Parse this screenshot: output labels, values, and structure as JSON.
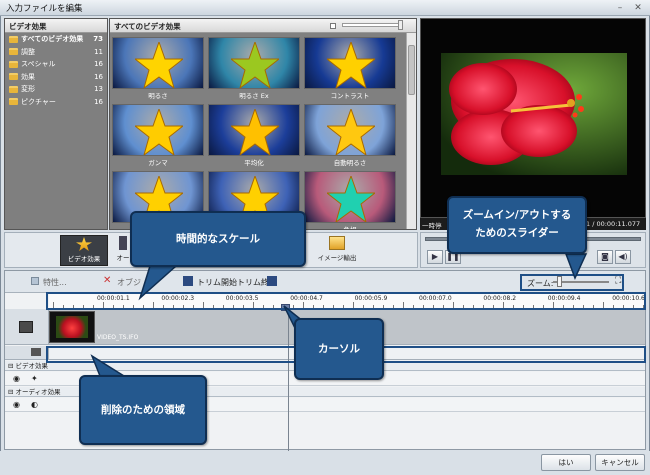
{
  "window": {
    "title": "入力ファイルを編集"
  },
  "categories": {
    "header": "ビデオ効果",
    "items": [
      {
        "label": "すべてのビデオ効果",
        "count": "73",
        "selected": true
      },
      {
        "label": "調整",
        "count": "11"
      },
      {
        "label": "スペシャル",
        "count": "16"
      },
      {
        "label": "効果",
        "count": "16"
      },
      {
        "label": "変形",
        "count": "13"
      },
      {
        "label": "ピクチャー",
        "count": "16"
      }
    ]
  },
  "effects": {
    "header": "すべてのビデオ効果",
    "tiles": [
      {
        "label": "明るさ",
        "bg": "#4b76b8",
        "star": "#ffd400"
      },
      {
        "label": "明るさ Ex",
        "bg": "#2f86a8",
        "star": "#9bc820"
      },
      {
        "label": "コントラスト",
        "bg": "#163a94",
        "star": "#ffd000"
      },
      {
        "label": "ガンマ",
        "bg": "#5f8fd0",
        "star": "#ffcc00"
      },
      {
        "label": "平均化",
        "bg": "#1c3e9a",
        "star": "#ffc000"
      },
      {
        "label": "自動明るさ",
        "bg": "#7ea3d8",
        "star": "#ffc810"
      },
      {
        "label": "",
        "bg": "#6f95d2",
        "star": "#ffd000"
      },
      {
        "label": "",
        "bg": "#3e62b6",
        "star": "#ffd000"
      },
      {
        "label": "色相",
        "bg": "#b85a7a",
        "star": "#20d0b0"
      }
    ]
  },
  "preview": {
    "time_left": "一時停",
    "time_right": "1 / 00:00:11.077"
  },
  "toolbar": {
    "video_effects": "ビデオ効果",
    "audio_effects": "オー",
    "image_export": "イメージ輸出"
  },
  "timeline": {
    "properties": "特性...",
    "delete_label": "オブジ",
    "trim_start": "トリム開始",
    "trim_end": "トリム終了",
    "zoom_label": "ズーム:",
    "ticks": [
      "00:00:01.1",
      "00:00:02.3",
      "00:00:03.5",
      "00:00:04.7",
      "00:00:05.9",
      "00:00:07.0",
      "00:00:08.2",
      "00:00:09.4",
      "00:00:10.6"
    ],
    "clip_name": "VIDEO_TS.IFO",
    "video_fx_section": "ビデオ効果",
    "audio_fx_section": "オーディオ効果"
  },
  "dialog": {
    "ok": "はい",
    "cancel": "キャンセル"
  },
  "callouts": {
    "scale": "時間的なスケール",
    "zoom": "ズームイン/アウトするためのスライダー",
    "cursor": "カーソル",
    "delete_area": "削除のための領域"
  },
  "colors": {
    "callout": "#24588e",
    "folder": "#e8b53a",
    "accent": "#1f4f86"
  }
}
